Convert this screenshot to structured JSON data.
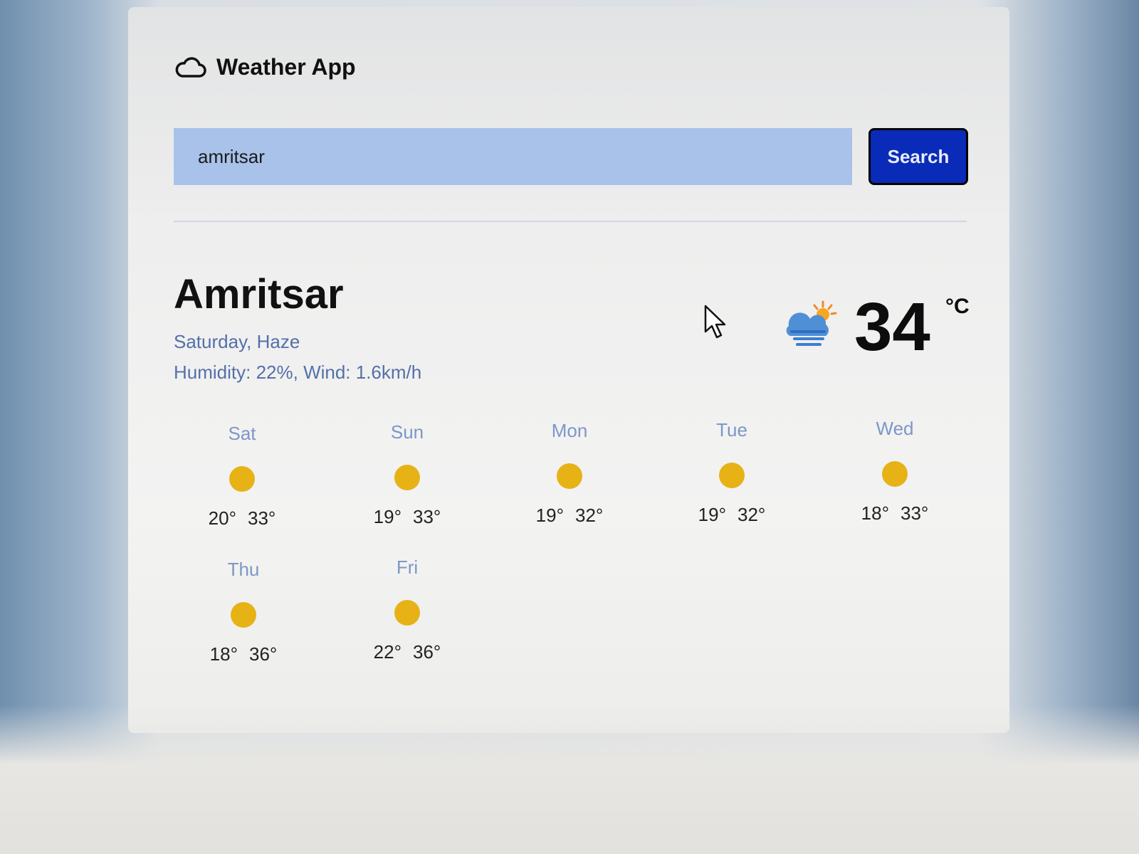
{
  "app": {
    "title": "Weather App",
    "icon": "cloud-icon"
  },
  "search": {
    "value": "amritsar",
    "button_label": "Search"
  },
  "current": {
    "city": "Amritsar",
    "day_condition": "Saturday, Haze",
    "stats": "Humidity: 22%, Wind: 1.6km/h",
    "temperature": "34",
    "unit": "°C",
    "icon": "haze-sun-icon"
  },
  "forecast": [
    {
      "day": "Sat",
      "low": "20°",
      "high": "33°",
      "icon": "sun-icon"
    },
    {
      "day": "Sun",
      "low": "19°",
      "high": "33°",
      "icon": "sun-icon"
    },
    {
      "day": "Mon",
      "low": "19°",
      "high": "32°",
      "icon": "sun-icon"
    },
    {
      "day": "Tue",
      "low": "19°",
      "high": "32°",
      "icon": "sun-icon"
    },
    {
      "day": "Wed",
      "low": "18°",
      "high": "33°",
      "icon": "sun-icon"
    },
    {
      "day": "Thu",
      "low": "18°",
      "high": "36°",
      "icon": "sun-icon"
    },
    {
      "day": "Fri",
      "low": "22°",
      "high": "36°",
      "icon": "sun-icon"
    }
  ],
  "colors": {
    "search_field_bg": "#a8c2ea",
    "search_button_bg": "#0a2bb8",
    "muted_text": "#5470a8",
    "sun": "#e6b216"
  }
}
